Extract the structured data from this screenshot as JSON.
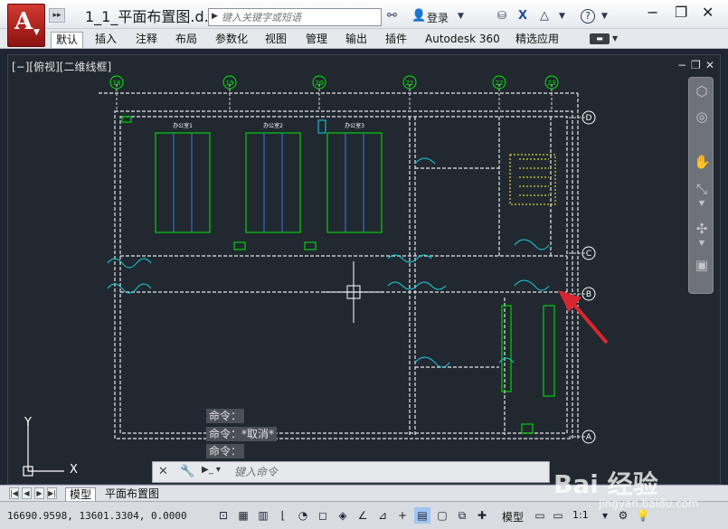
{
  "titlebar": {
    "doc_title": "1_1_平面布置图.d...",
    "search_placeholder": "键入关键字或短语",
    "login_label": "登录",
    "help_label": "?"
  },
  "ribbon": {
    "tabs": [
      "默认",
      "插入",
      "注释",
      "布局",
      "参数化",
      "视图",
      "管理",
      "输出",
      "插件",
      "Autodesk 360",
      "精选应用"
    ]
  },
  "viewport": {
    "label": "[−][俯视][二维线框]",
    "grid_bubbles_top": [
      "18",
      "19",
      "20",
      "21",
      "22",
      "23"
    ],
    "grid_bubbles_right": [
      "D",
      "C",
      "B",
      "A"
    ],
    "room_labels": [
      "办公室1",
      "办公室2",
      "办公室3"
    ]
  },
  "command": {
    "history": [
      "命令：",
      "命令：*取消*",
      "命令："
    ],
    "placeholder": "键入命令"
  },
  "layout_tabs": [
    "模型",
    "平面布置图"
  ],
  "statusbar": {
    "coords": "16690.9598, 13601.3304, 0.0000",
    "model_label": "模型",
    "scale_label": "1:1"
  },
  "watermark": {
    "text": "Bai 经验",
    "sub": "jingyan.baidu.com"
  },
  "colors": {
    "canvas": "#212830",
    "accent_red": "#c0282a",
    "cad_green": "#00ff00",
    "cad_cyan": "#00e5ff",
    "cad_yellow": "#ffff00"
  }
}
